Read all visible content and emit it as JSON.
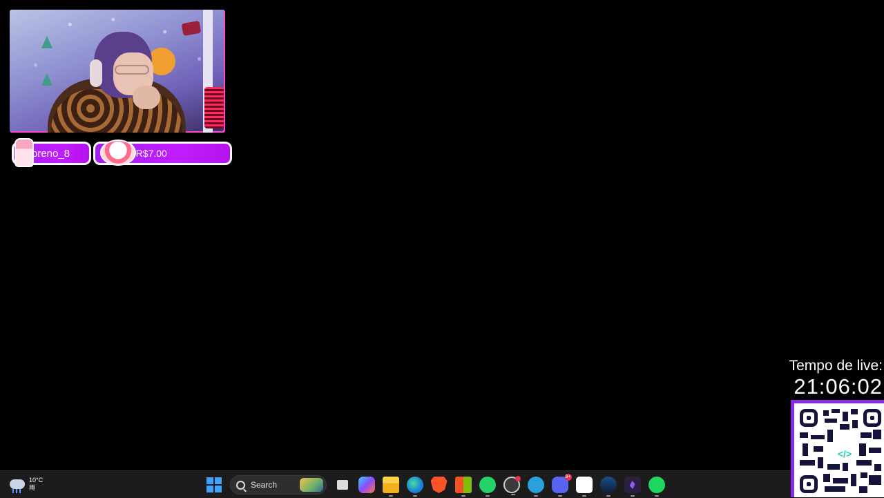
{
  "overlay": {
    "alerts": {
      "user_label": "oreno_8",
      "money_label": "ts: R$7.00"
    },
    "timer": {
      "label": "Tempo de live:",
      "value": "21:06:02"
    },
    "accent_color": "#c21dff"
  },
  "taskbar": {
    "weather": {
      "temp": "10°C",
      "condition": "雨"
    },
    "search_placeholder": "Search",
    "apps": [
      "windows-start-icon",
      "search-box",
      "task-view-icon",
      "copilot-icon",
      "file-explorer-icon",
      "edge-icon",
      "brave-icon",
      "microsoft-store-icon",
      "whatsapp-icon",
      "obs-icon",
      "telegram-icon",
      "discord-icon",
      "streamer-app-icon",
      "steam-icon",
      "obsidian-icon",
      "spotify-icon"
    ],
    "discord_badge": "9+"
  }
}
